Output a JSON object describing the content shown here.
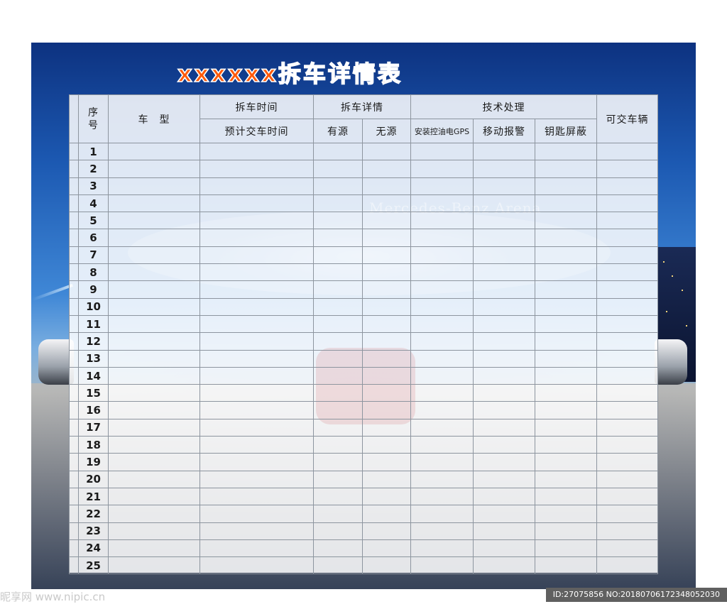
{
  "title": "xxxxxx拆车详情表",
  "watermark_arena": "Mercedes-Benz Arena",
  "table": {
    "header": {
      "seq": "序号",
      "model": "车　型",
      "removal_time": "拆车时间",
      "est_delivery_time": "预计交车时间",
      "removal_details": "拆车详情",
      "has_source": "有源",
      "no_source": "无源",
      "tech_processing": "技术处理",
      "install_gps": "安装控油电GPS",
      "mobile_alarm": "移动报警",
      "key_shield": "钥匙屏蔽",
      "deliverable": "可交车辆"
    },
    "rows": [
      "1",
      "2",
      "3",
      "4",
      "5",
      "6",
      "7",
      "8",
      "9",
      "10",
      "11",
      "12",
      "13",
      "14",
      "15",
      "16",
      "17",
      "18",
      "19",
      "20",
      "21",
      "22",
      "23",
      "24",
      "25"
    ]
  },
  "footer": {
    "site_watermark": "昵享网 www.nipic.cn",
    "id_watermark": "ID:27075856 NO:20180706172348052030"
  }
}
